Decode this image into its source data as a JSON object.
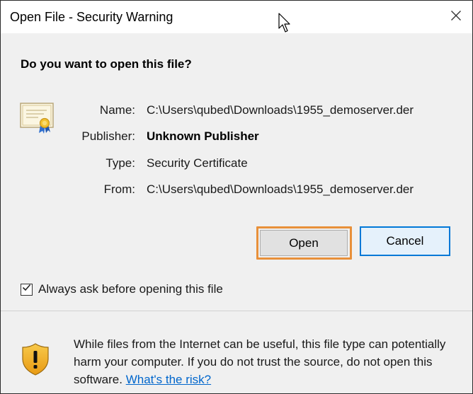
{
  "window": {
    "title": "Open File - Security Warning"
  },
  "question": "Do you want to open this file?",
  "details": {
    "name_label": "Name:",
    "name_value": "C:\\Users\\qubed\\Downloads\\1955_demoserver.der",
    "publisher_label": "Publisher:",
    "publisher_value": "Unknown Publisher",
    "type_label": "Type:",
    "type_value": "Security Certificate",
    "from_label": "From:",
    "from_value": "C:\\Users\\qubed\\Downloads\\1955_demoserver.der"
  },
  "buttons": {
    "open_label": "Open",
    "cancel_label": "Cancel"
  },
  "checkbox": {
    "label": "Always ask before opening this file",
    "checked": true
  },
  "warning": {
    "text": "While files from the Internet can be useful, this file type can potentially harm your computer. If you do not trust the source, do not open this software. ",
    "link_text": "What's the risk?"
  },
  "colors": {
    "highlight": "#e8903a",
    "accent": "#0078d7",
    "link": "#0066cc"
  },
  "icons": {
    "close": "close-icon",
    "certificate": "certificate-icon",
    "shield": "shield-warning-icon",
    "check": "check-icon",
    "cursor": "mouse-cursor-icon"
  }
}
